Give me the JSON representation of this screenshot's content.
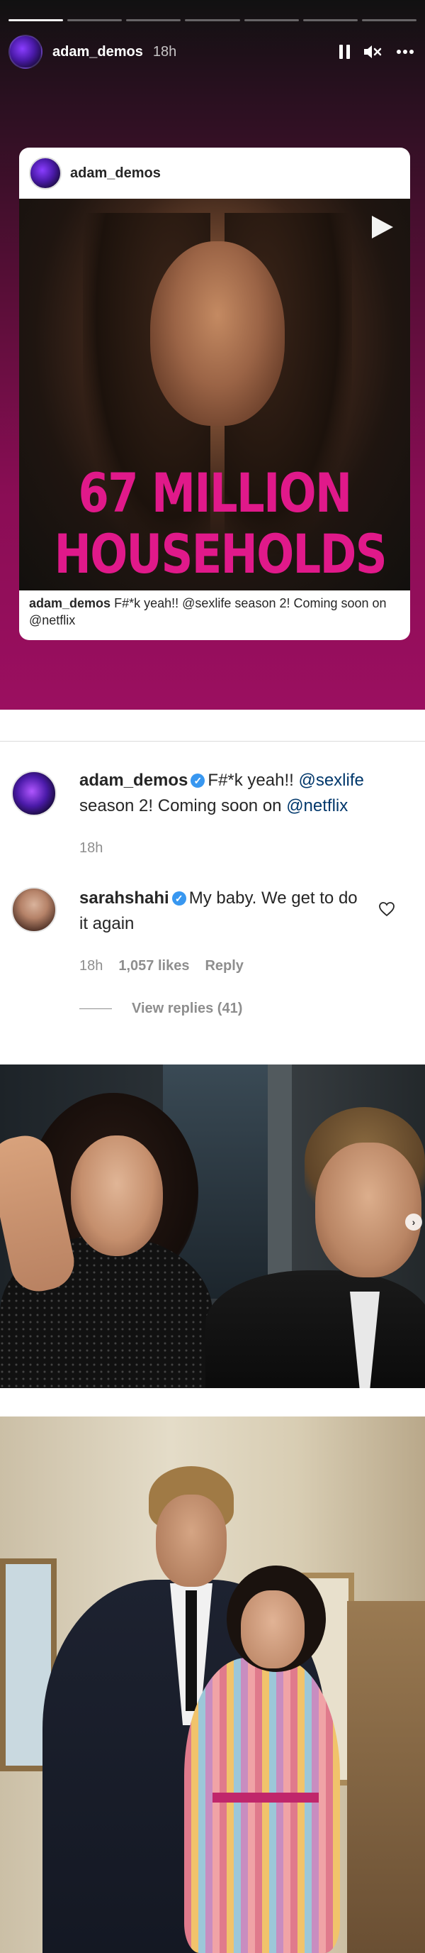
{
  "story": {
    "progress_segments": 7,
    "active_segment": 0,
    "username": "adam_demos",
    "time": "18h",
    "icons": [
      "pause-icon",
      "mute-icon",
      "more-icon"
    ]
  },
  "post_card": {
    "username": "adam_demos",
    "headline_line1": "67 MILLION",
    "headline_line2": "HOUSEHOLDS",
    "caption_user": "adam_demos",
    "caption_text": "F#*k yeah!! @sexlife season 2! Coming soon on @netflix",
    "play_icon": "play-icon"
  },
  "comments": {
    "owner": {
      "username": "adam_demos",
      "text_before": "F#*k yeah!! ",
      "mention1": "@sexlife",
      "text_middle": " season 2! Coming soon on ",
      "mention2": "@netflix",
      "time": "18h"
    },
    "reply": {
      "username": "sarahshahi",
      "text": "My baby. We get to do it again",
      "time": "18h",
      "likes": "1,057 likes",
      "reply_label": "Reply",
      "view_replies": "View replies (41)"
    }
  },
  "colors": {
    "headline": "#e0198a",
    "link": "#00376b",
    "meta": "#8e8e8e",
    "verified": "#3897f0"
  }
}
